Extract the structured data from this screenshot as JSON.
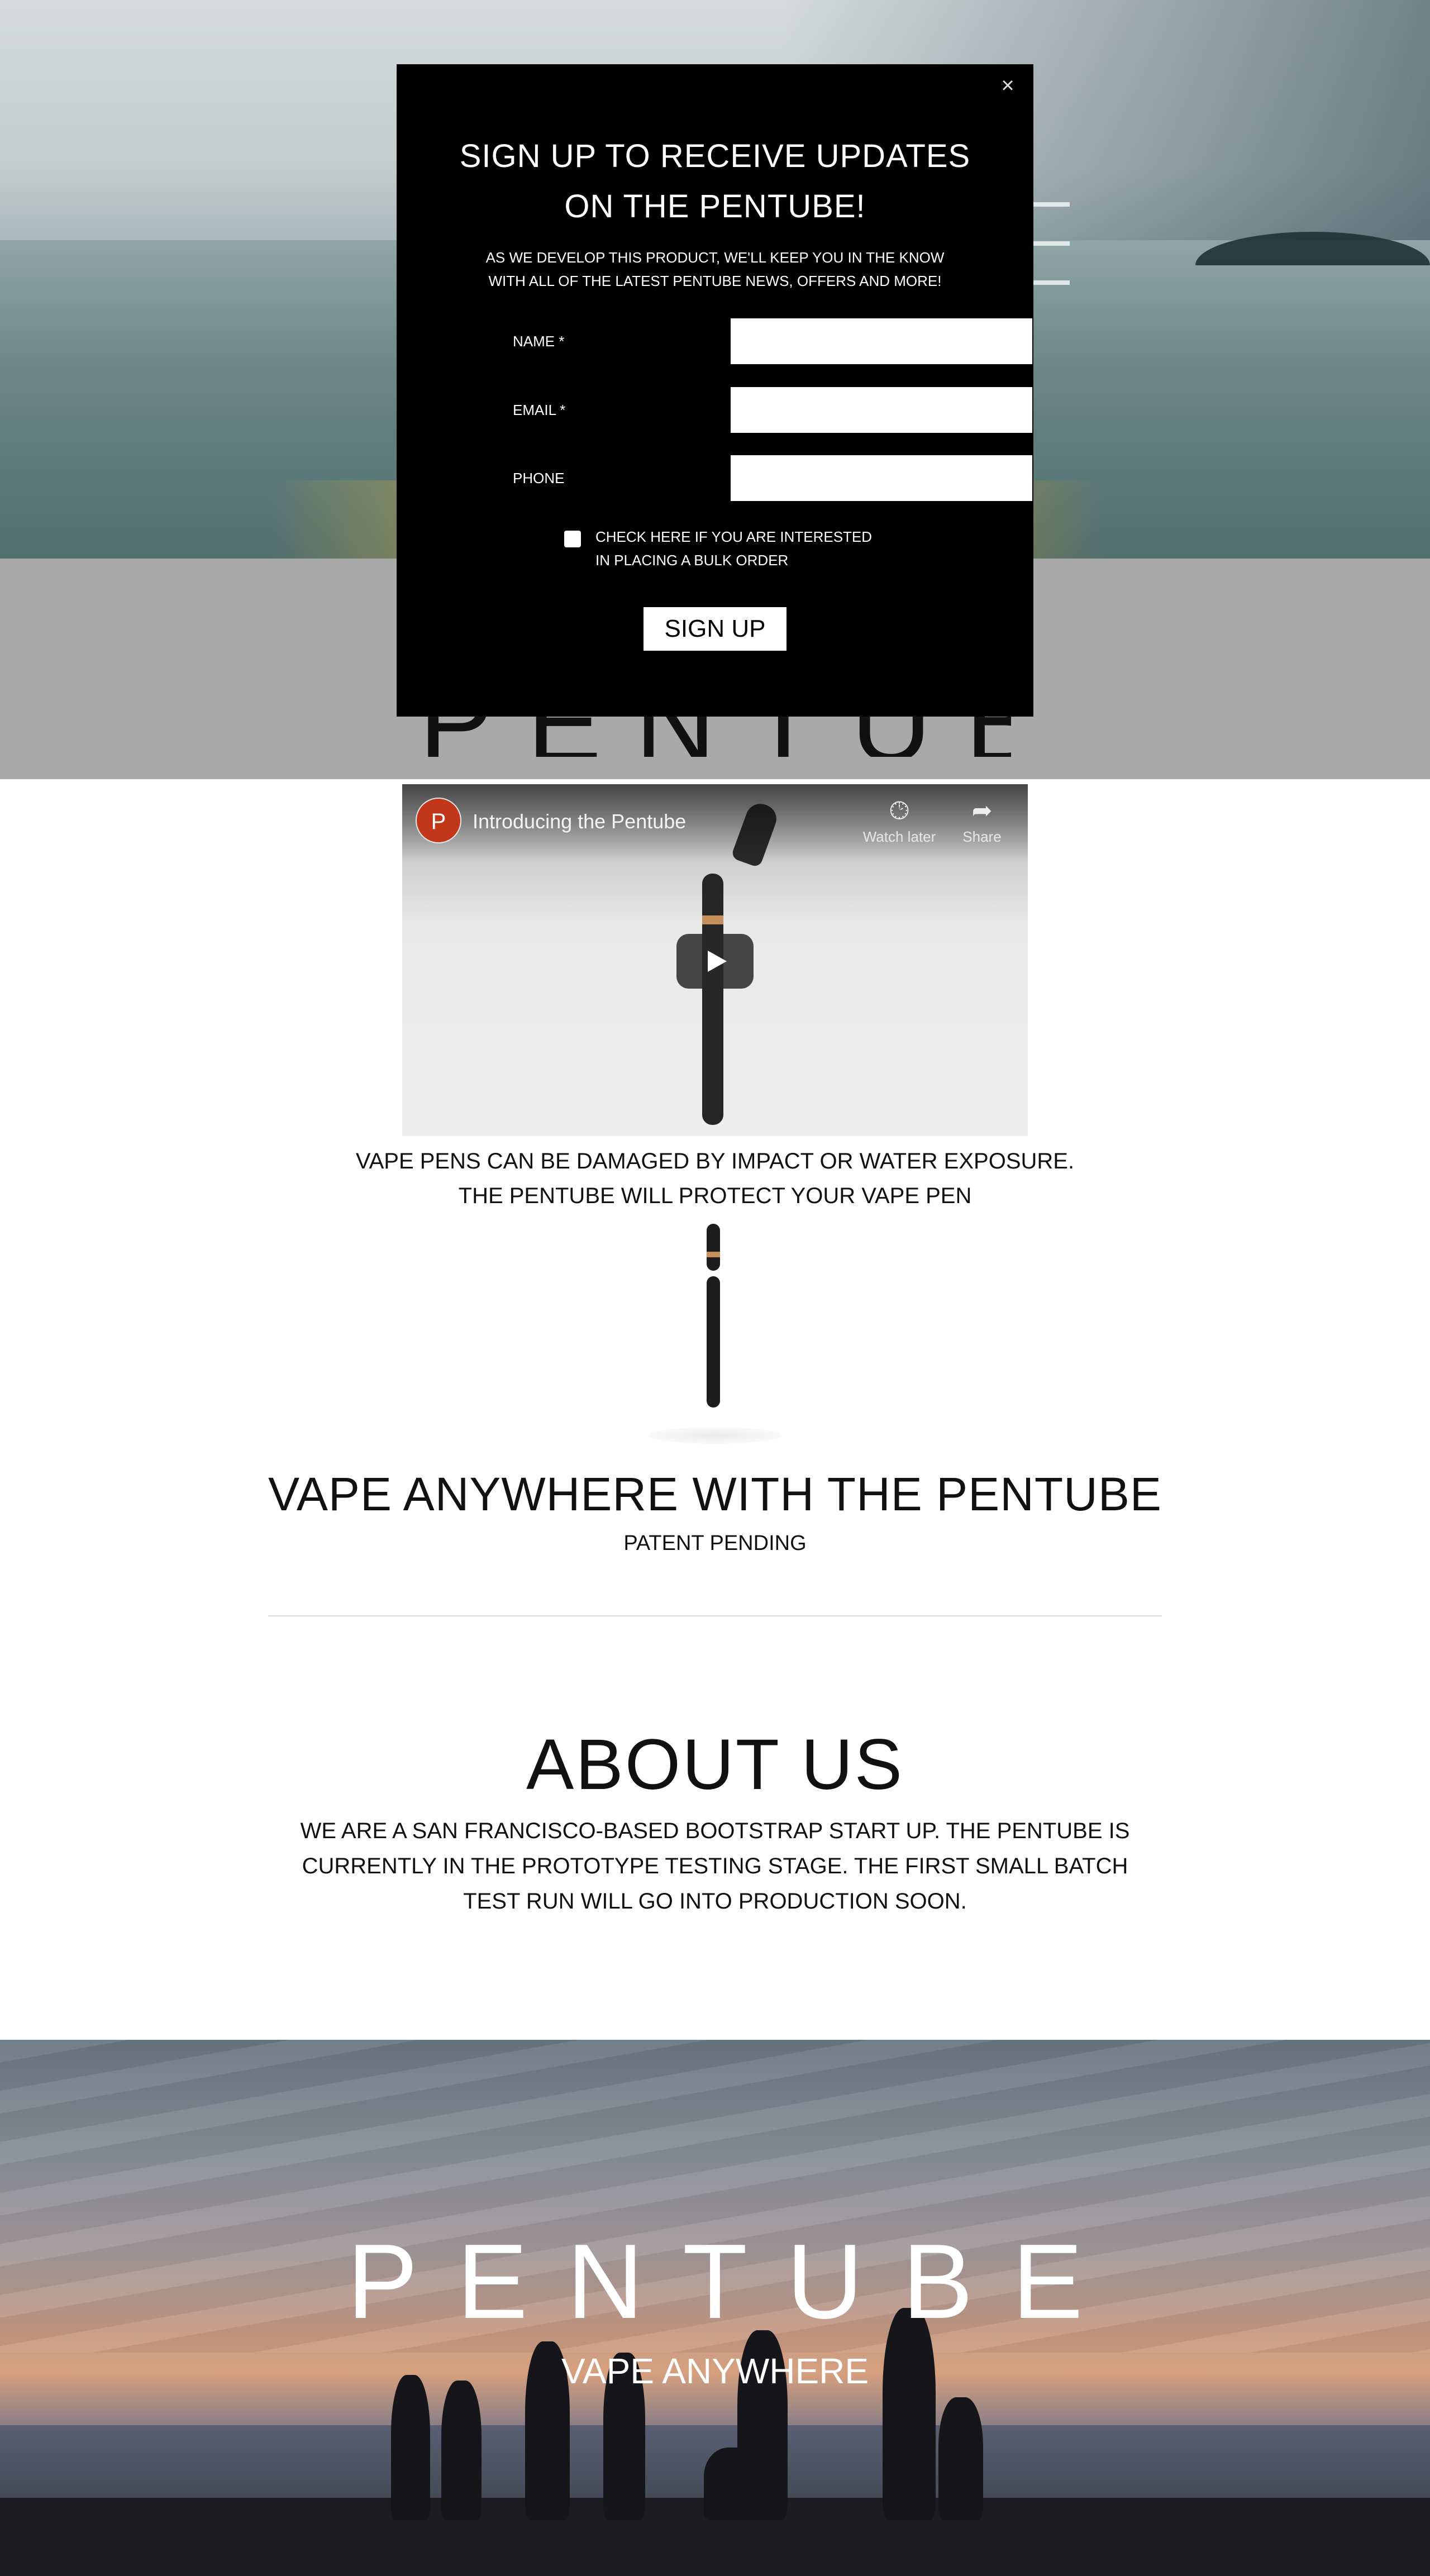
{
  "modal": {
    "close": "×",
    "title_line1": "SIGN UP TO RECEIVE UPDATES",
    "title_line2": "ON THE PENTUBE!",
    "sub_line1": "AS WE DEVELOP THIS PRODUCT, WE'LL KEEP YOU IN THE KNOW",
    "sub_line2": "WITH ALL OF THE LATEST PENTUBE NEWS, OFFERS AND MORE!",
    "fields": [
      {
        "label": "NAME *",
        "value": ""
      },
      {
        "label": "EMAIL *",
        "value": ""
      },
      {
        "label": "PHONE",
        "value": ""
      }
    ],
    "checkbox_line1": "CHECK HERE IF YOU ARE INTERESTED",
    "checkbox_line2": "IN PLACING A BULK ORDER",
    "checkbox_checked": false,
    "submit": "SIGN UP"
  },
  "background_logo": "PENTUBE",
  "video": {
    "channel_initial": "P",
    "title": "Introducing the Pentube",
    "watch_later": "Watch later",
    "share": "Share",
    "watch_later_icon": "clock-icon",
    "share_icon": "share-arrow-icon",
    "play_icon": "play-icon"
  },
  "warning": {
    "line1": "VAPE PENS CAN BE DAMAGED BY IMPACT OR WATER EXPOSURE.",
    "line2": "THE PENTUBE WILL PROTECT YOUR VAPE PEN"
  },
  "vape": {
    "title": "VAPE ANYWHERE WITH THE PENTUBE",
    "subtitle": "PATENT PENDING"
  },
  "about": {
    "title": "ABOUT US",
    "line1": "WE ARE A SAN FRANCISCO-BASED BOOTSTRAP START UP. THE PENTUBE IS",
    "line2": "CURRENTLY IN THE PROTOTYPE TESTING STAGE. THE FIRST SMALL BATCH",
    "line3": "TEST RUN WILL GO INTO PRODUCTION SOON."
  },
  "footer": {
    "logo": "PENTUBE",
    "tagline": "VAPE ANYWHERE"
  },
  "colors": {
    "modal_bg": "#000000",
    "youtube_avatar": "#c2361a",
    "pen_accent": "#c58f5a"
  }
}
